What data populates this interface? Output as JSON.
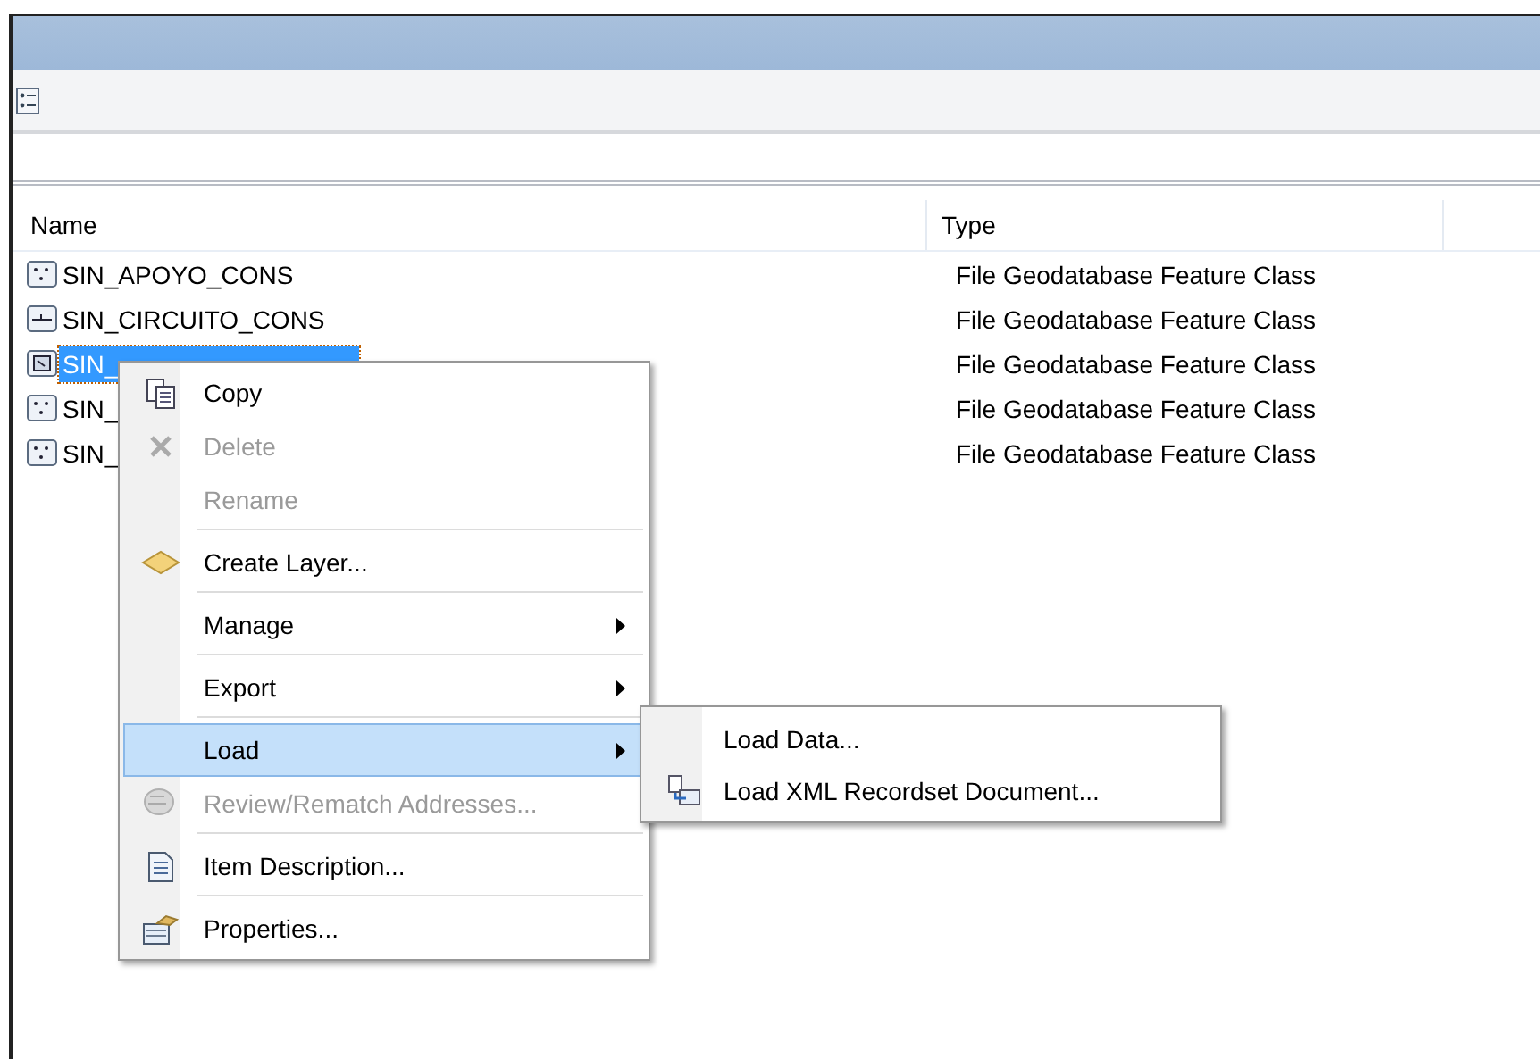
{
  "table": {
    "columns": [
      "Name",
      "Type"
    ],
    "rows": [
      {
        "name": "SIN_APOYO_CONS",
        "type": "File Geodatabase Feature Class",
        "kind": "point",
        "selected": false
      },
      {
        "name": "SIN_CIRCUITO_CONS",
        "type": "File Geodatabase Feature Class",
        "kind": "line",
        "selected": false
      },
      {
        "name": "SIN_",
        "type": "File Geodatabase Feature Class",
        "kind": "polygon",
        "selected": true
      },
      {
        "name": "SIN_",
        "type": "File Geodatabase Feature Class",
        "kind": "point",
        "selected": false
      },
      {
        "name": "SIN_",
        "type": "File Geodatabase Feature Class",
        "kind": "point",
        "selected": false
      }
    ]
  },
  "context_menu": {
    "items": [
      {
        "label": "Copy",
        "disabled": false,
        "selected": false,
        "submenu": false,
        "separator_after": false
      },
      {
        "label": "Delete",
        "disabled": true,
        "selected": false,
        "submenu": false,
        "separator_after": false
      },
      {
        "label": "Rename",
        "disabled": true,
        "selected": false,
        "submenu": false,
        "separator_after": true
      },
      {
        "label": "Create Layer...",
        "disabled": false,
        "selected": false,
        "submenu": false,
        "separator_after": true
      },
      {
        "label": "Manage",
        "disabled": false,
        "selected": false,
        "submenu": true,
        "separator_after": true
      },
      {
        "label": "Export",
        "disabled": false,
        "selected": false,
        "submenu": true,
        "separator_after": true
      },
      {
        "label": "Load",
        "disabled": false,
        "selected": true,
        "submenu": true,
        "separator_after": false
      },
      {
        "label": "Review/Rematch Addresses...",
        "disabled": true,
        "selected": false,
        "submenu": false,
        "separator_after": true
      },
      {
        "label": "Item Description...",
        "disabled": false,
        "selected": false,
        "submenu": false,
        "separator_after": true
      },
      {
        "label": "Properties...",
        "disabled": false,
        "selected": false,
        "submenu": false,
        "separator_after": false
      }
    ]
  },
  "submenu": {
    "items": [
      {
        "label": "Load Data..."
      },
      {
        "label": "Load XML Recordset Document..."
      }
    ]
  }
}
